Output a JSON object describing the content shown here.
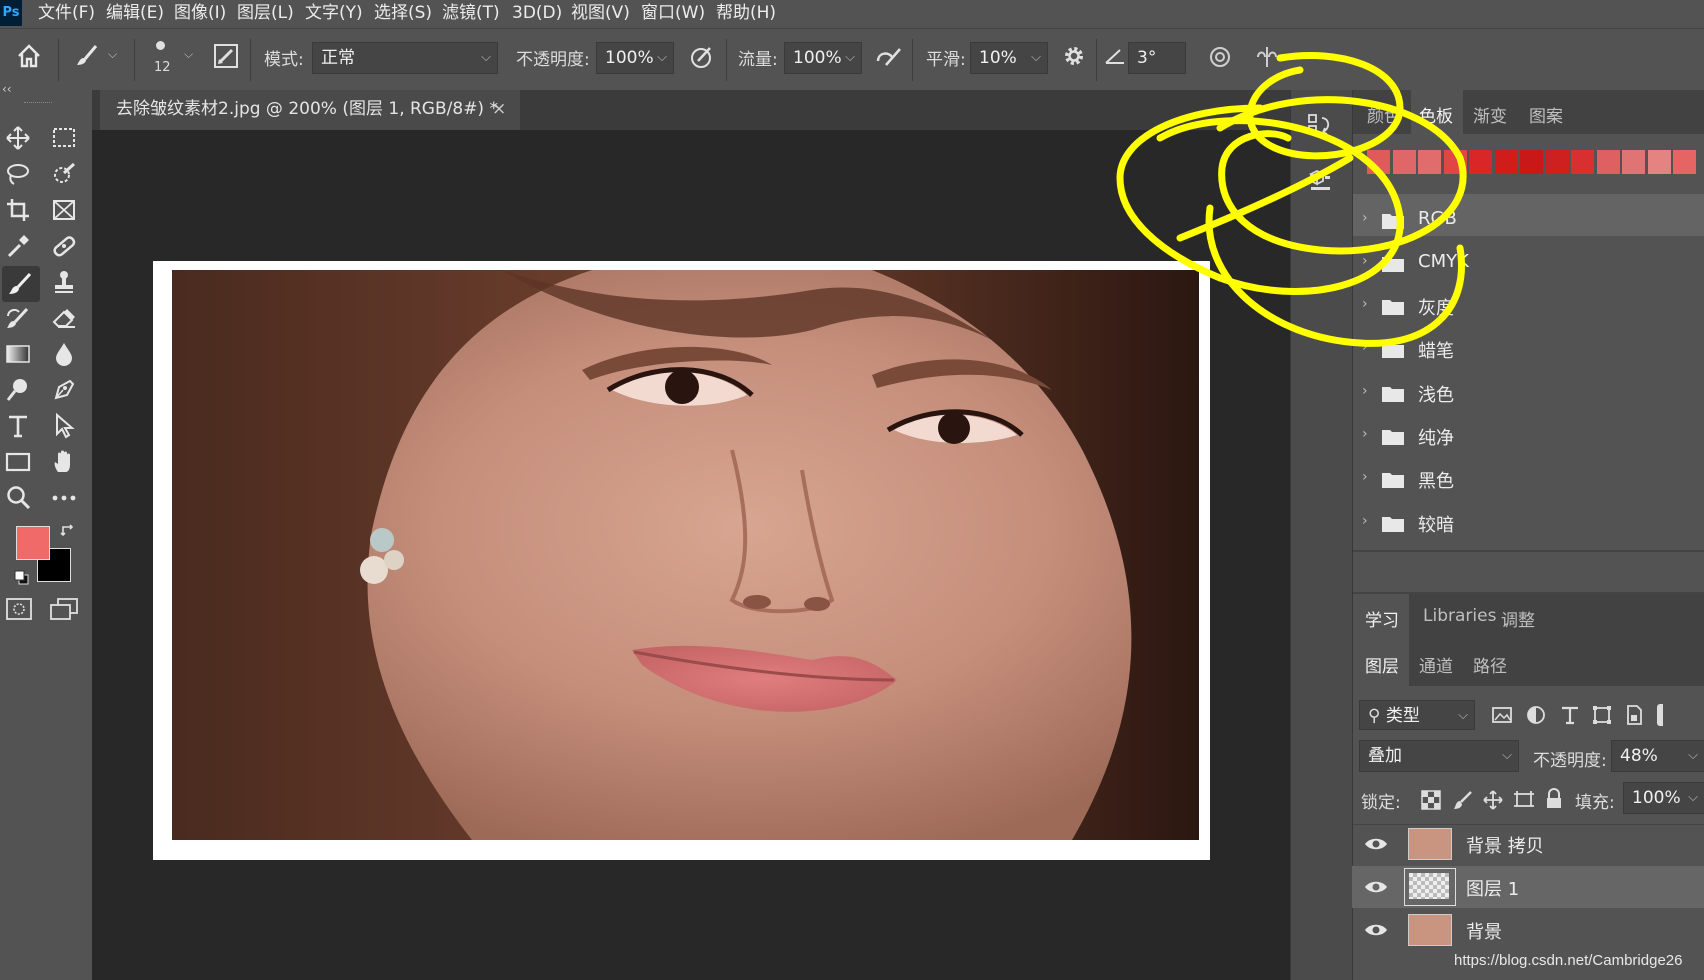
{
  "app": {
    "logo": "Ps"
  },
  "menu": [
    "文件(F)",
    "编辑(E)",
    "图像(I)",
    "图层(L)",
    "文字(Y)",
    "选择(S)",
    "滤镜(T)",
    "3D(D)",
    "视图(V)",
    "窗口(W)",
    "帮助(H)"
  ],
  "options": {
    "brush_size": "12",
    "mode_label": "模式:",
    "mode_value": "正常",
    "opacity_label": "不透明度:",
    "opacity_value": "100%",
    "flow_label": "流量:",
    "flow_value": "100%",
    "smooth_label": "平滑:",
    "smooth_value": "10%",
    "angle_value": "3°"
  },
  "document": {
    "tab_title": "去除皱纹素材2.jpg @ 200% (图层 1, RGB/8#) *",
    "close": "×"
  },
  "tools": {
    "collapse": "‹‹",
    "foreground_color": "#f06a6a",
    "background_color": "#000000"
  },
  "swatches_panel": {
    "tabs": [
      "颜色",
      "色板",
      "渐变",
      "图案"
    ],
    "active_tab": "色板",
    "swatch_colors": [
      "#e05a5a",
      "#e06767",
      "#e06c6c",
      "#e04646",
      "#d92626",
      "#d11c1c",
      "#c81818",
      "#cf2020",
      "#d83030",
      "#de6060",
      "#e07373",
      "#e58383",
      "#e56565"
    ],
    "folders": [
      "RGB",
      "CMYK",
      "灰度",
      "蜡笔",
      "浅色",
      "纯净",
      "黑色",
      "较暗"
    ]
  },
  "learn_panel": {
    "tabs": [
      "学习",
      "Libraries",
      "调整"
    ],
    "active_tab": "学习"
  },
  "layers_panel": {
    "tabs": [
      "图层",
      "通道",
      "路径"
    ],
    "active_tab": "图层",
    "filter_label": "类型",
    "blend_mode": "叠加",
    "opacity_label": "不透明度:",
    "opacity_value": "48%",
    "lock_label": "锁定:",
    "fill_label": "填充:",
    "fill_value": "100%",
    "layers": [
      {
        "name": "背景 拷贝",
        "visible": true,
        "selected": false
      },
      {
        "name": "图层 1",
        "visible": true,
        "selected": true
      },
      {
        "name": "背景",
        "visible": true,
        "selected": false
      }
    ]
  },
  "watermark": "https://blog.csdn.net/Cambridge26",
  "annotation_color": "#ffff00"
}
